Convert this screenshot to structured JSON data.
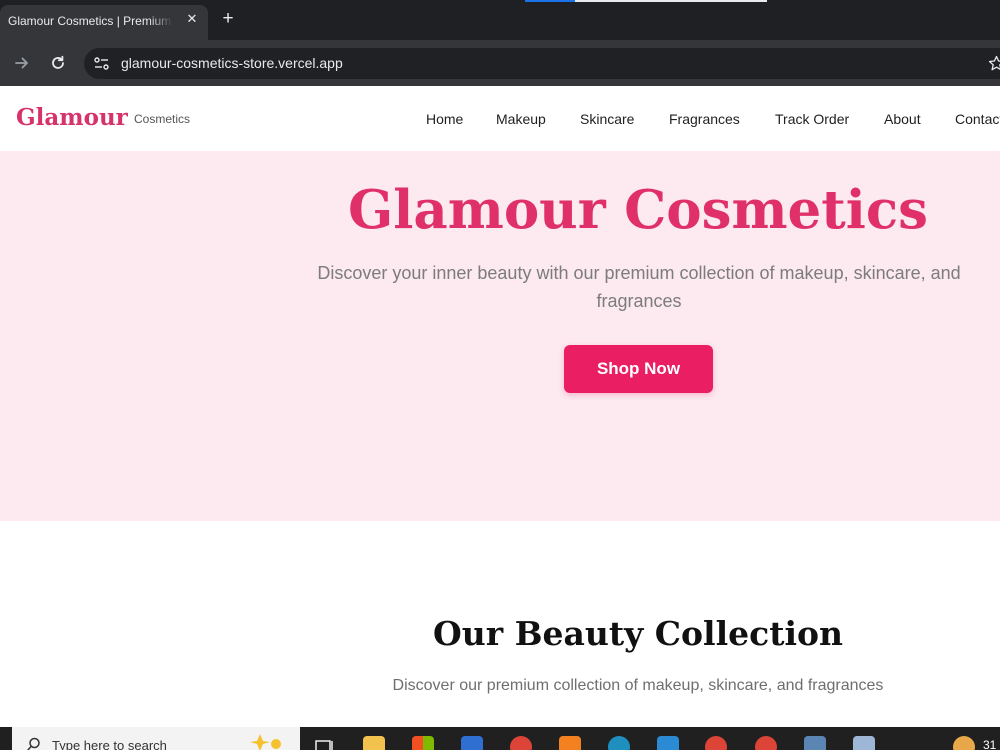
{
  "browser": {
    "tab_title": "Glamour Cosmetics | Premium Makeup",
    "url": "glamour-cosmetics-store.vercel.app"
  },
  "site": {
    "logo": "Glamour",
    "logo_sub": "Cosmetics",
    "nav": [
      "Home",
      "Makeup",
      "Skincare",
      "Fragrances",
      "Track Order",
      "About",
      "Contact"
    ]
  },
  "hero": {
    "title": "Glamour Cosmetics",
    "description": "Discover your inner beauty with our premium collection of makeup, skincare, and fragrances",
    "cta": "Shop Now"
  },
  "collection": {
    "title": "Our Beauty Collection",
    "description": "Discover our premium collection of makeup, skincare, and fragrances"
  },
  "taskbar": {
    "search_placeholder": "Type here to search",
    "clock": "31"
  },
  "colors": {
    "brand": "#e91e63",
    "hero_bg": "#fde9f0"
  }
}
